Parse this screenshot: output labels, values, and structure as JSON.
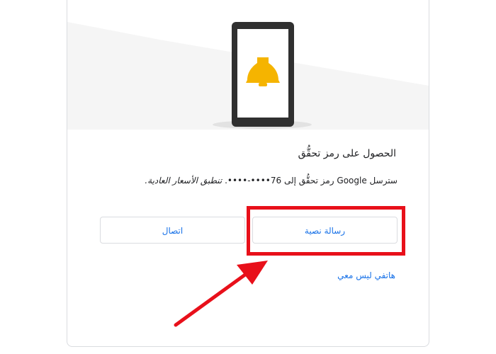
{
  "verification": {
    "title": "الحصول على رمز تحقُّق",
    "description_main": "سترسل Google رمز تحقُّق إلى 76••••-••••.",
    "description_rates": "تنطبق الأسعار العادية.",
    "sms_button": "رسالة نصية",
    "call_button": "اتصال",
    "no_phone_link": "هاتفي ليس معي"
  },
  "icons": {
    "hero": "phone-bell-icon",
    "annotation": "red-arrow-icon"
  },
  "colors": {
    "accent": "#1a73e8",
    "annotation_red": "#e8101a",
    "bell": "#f5b400",
    "phone_frame": "#303030"
  }
}
